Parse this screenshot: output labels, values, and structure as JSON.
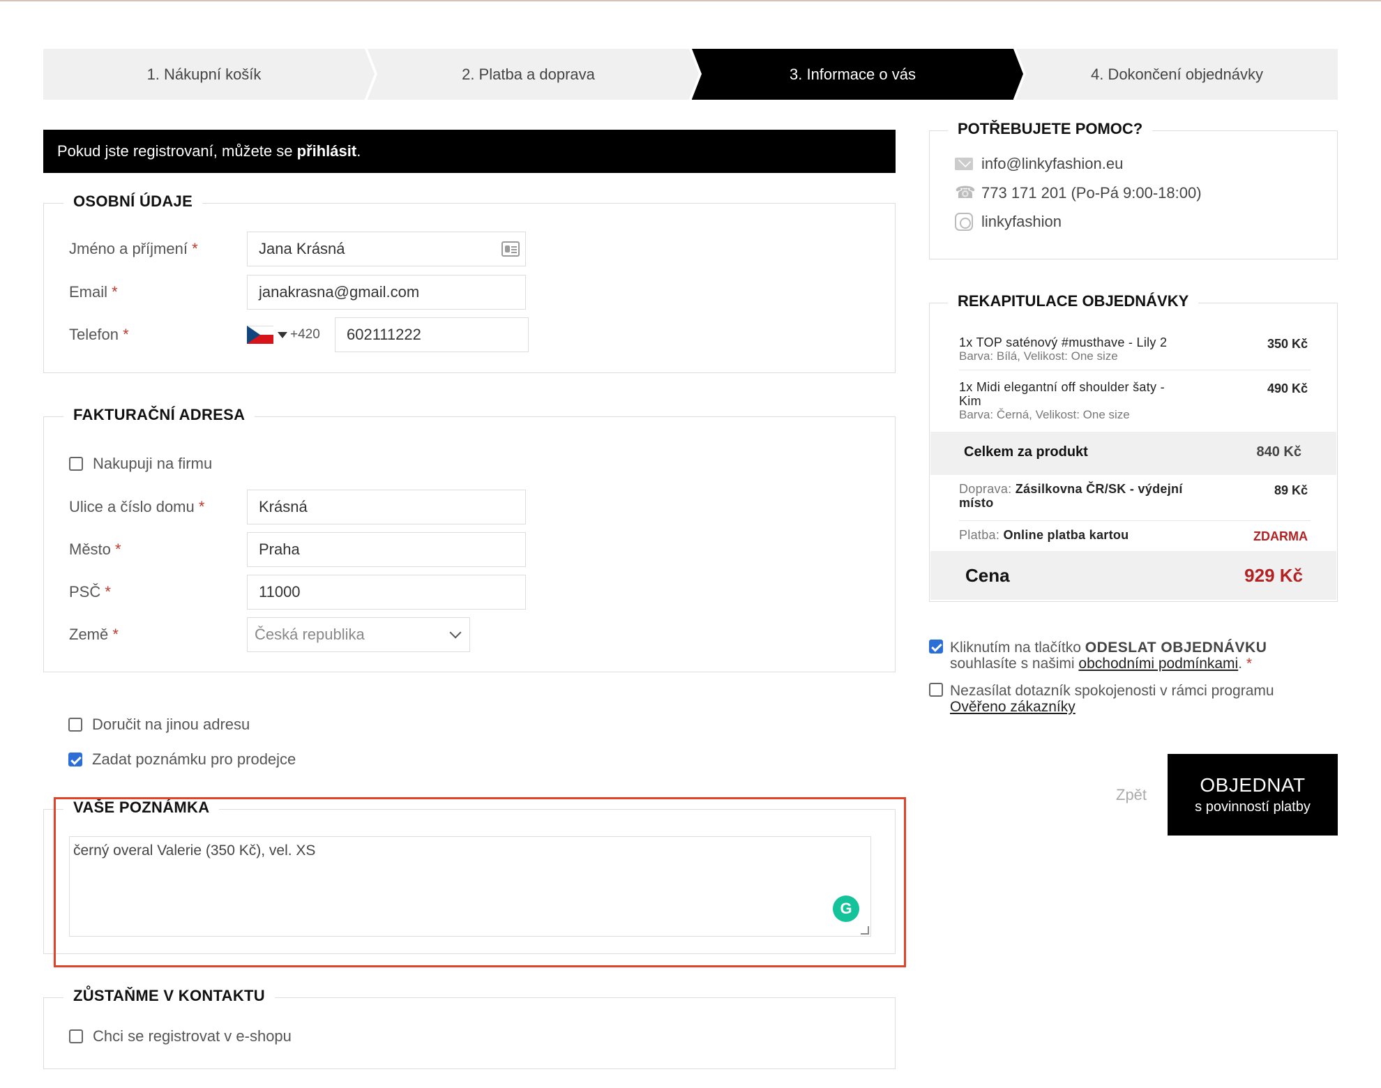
{
  "steps": [
    {
      "label": "1. Nákupní košík"
    },
    {
      "label": "2. Platba a doprava"
    },
    {
      "label": "3. Informace o vás"
    },
    {
      "label": "4. Dokončení objednávky"
    }
  ],
  "login": {
    "prefix": "Pokud jste registrovaní, můžete se ",
    "link": "přihlásit",
    "suffix": "."
  },
  "required_mark": "*",
  "personal": {
    "title": "OSOBNÍ ÚDAJE",
    "name_label": "Jméno a příjmení",
    "name_value": "Jana Krásná",
    "email_label": "Email",
    "email_value": "janakrasna@gmail.com",
    "phone_label": "Telefon",
    "phone_dial": "+420",
    "phone_value": "602111222"
  },
  "billing": {
    "title": "FAKTURAČNÍ ADRESA",
    "company_label": "Nakupuji na firmu",
    "street_label": "Ulice a číslo domu",
    "street_value": "Krásná",
    "city_label": "Město",
    "city_value": "Praha",
    "zip_label": "PSČ",
    "zip_value": "11000",
    "country_label": "Země",
    "country_value": "Česká republika"
  },
  "options": {
    "other_address": "Doručit na jinou adresu",
    "seller_note": "Zadat poznámku pro prodejce"
  },
  "note": {
    "title": "VAŠE POZNÁMKA",
    "value": "černý overal Valerie (350 Kč), vel. XS",
    "grammarly": "G"
  },
  "stay": {
    "title": "ZŮSTAŇME V KONTAKTU",
    "register_label": "Chci se registrovat v e-shopu"
  },
  "help": {
    "title": "POTŘEBUJETE POMOC?",
    "email": "info@linkyfashion.eu",
    "phone": "773 171 201 (Po-Pá 9:00-18:00)",
    "instagram": "linkyfashion",
    "phone_glyph": "☎"
  },
  "summary": {
    "title": "REKAPITULACE OBJEDNÁVKY",
    "items": [
      {
        "name": "1x TOP saténový #musthave - Lily 2",
        "variant": "Barva: Bílá, Velikost: One size",
        "price": "350 Kč"
      },
      {
        "name": "1x Midi elegantní off shoulder šaty - Kim",
        "variant": "Barva: Černá, Velikost: One size",
        "price": "490 Kč"
      }
    ],
    "subtotal_label": "Celkem za produkt",
    "subtotal_value": "840 Kč",
    "shipping_prefix": "Doprava: ",
    "shipping_name": "Zásilkovna ČR/SK - výdejní místo",
    "shipping_price": "89 Kč",
    "payment_prefix": "Platba: ",
    "payment_name": "Online platba kartou",
    "payment_price": "ZDARMA",
    "total_label": "Cena",
    "total_value": "929 Kč"
  },
  "terms": {
    "prefix": "Kliknutím na tlačítko ",
    "bold": "ODESLAT OBJEDNÁVKU",
    "middle": " souhlasíte s našimi ",
    "link": "obchodními podmínkami",
    "suffix": ". "
  },
  "survey": {
    "text": "Nezasílat dotazník spokojenosti v rámci programu ",
    "link": "Ověřeno zákazníky"
  },
  "actions": {
    "back": "Zpět",
    "order_main": "OBJEDNAT",
    "order_sub": "s povinností platby"
  },
  "colors": {
    "accent_red": "#b22222",
    "highlight": "#e2432a",
    "check_blue": "#2b6fd6"
  }
}
